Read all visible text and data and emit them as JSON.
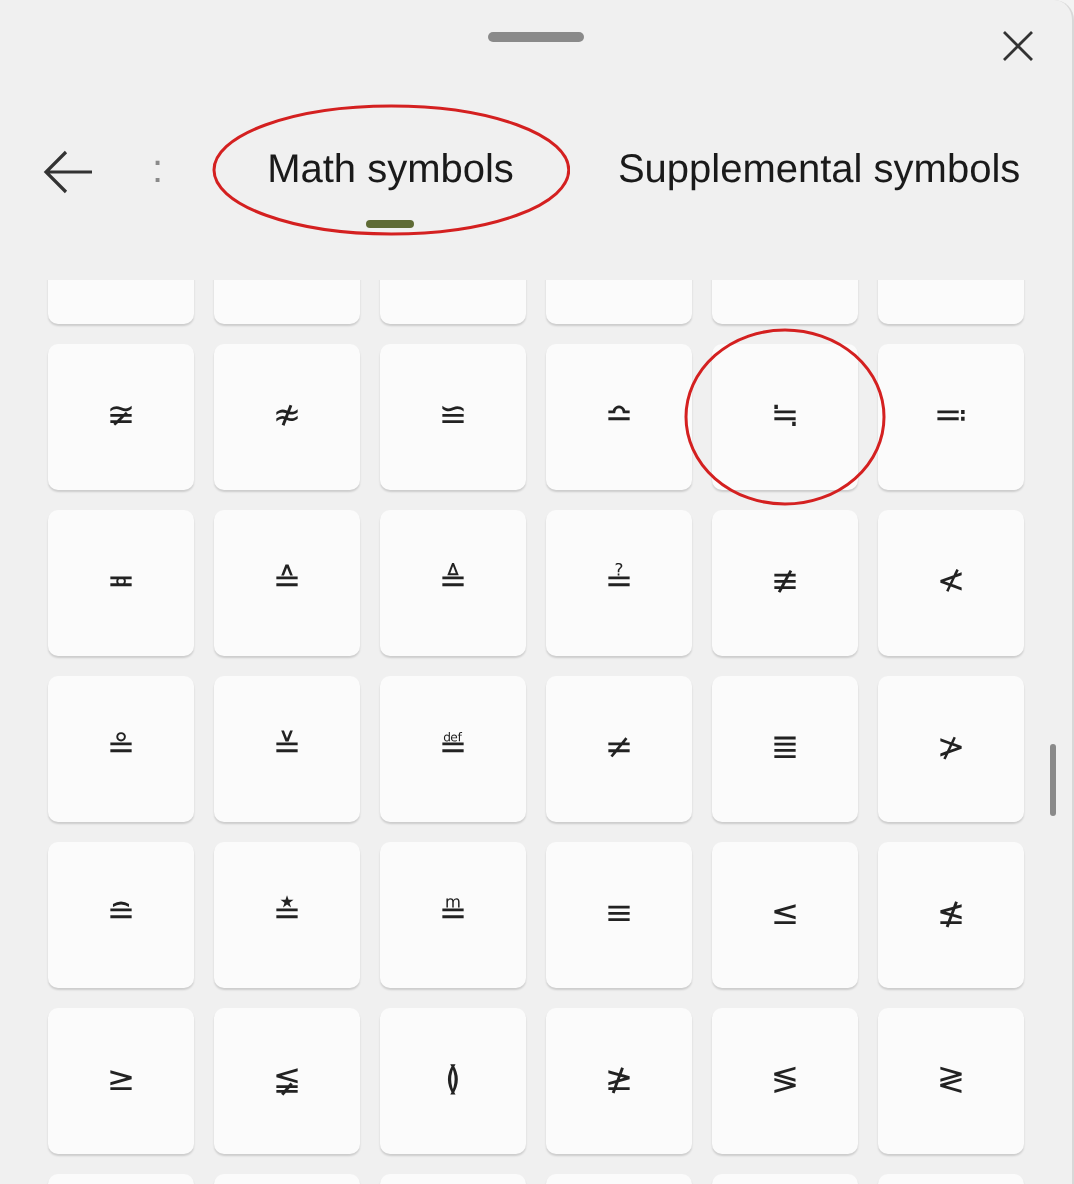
{
  "tabs": [
    {
      "label": ":",
      "selected": false,
      "circled": false
    },
    {
      "label": "Math symbols",
      "selected": true,
      "circled": true
    },
    {
      "label": "Supplemental symbols",
      "selected": false,
      "circled": false
    }
  ],
  "symbols": [
    {
      "symbol": "≆",
      "circled": false
    },
    {
      "symbol": "≉",
      "circled": false
    },
    {
      "symbol": "≌",
      "circled": false
    },
    {
      "symbol": "≏",
      "circled": false
    },
    {
      "symbol": "≒",
      "circled": true
    },
    {
      "symbol": "≕",
      "circled": false
    },
    {
      "symbol": "≖",
      "circled": false
    },
    {
      "symbol": "≙",
      "circled": false
    },
    {
      "symbol": "≜",
      "circled": false
    },
    {
      "symbol": "≟",
      "circled": false
    },
    {
      "symbol": "≢",
      "circled": false
    },
    {
      "symbol": "≮",
      "circled": false
    },
    {
      "symbol": "≗",
      "circled": false
    },
    {
      "symbol": "≚",
      "circled": false
    },
    {
      "symbol": "≝",
      "circled": false
    },
    {
      "symbol": "≠",
      "circled": false
    },
    {
      "symbol": "≣",
      "circled": false
    },
    {
      "symbol": "≯",
      "circled": false
    },
    {
      "symbol": "≘",
      "circled": false
    },
    {
      "symbol": "≛",
      "circled": false
    },
    {
      "symbol": "≞",
      "circled": false
    },
    {
      "symbol": "≡",
      "circled": false
    },
    {
      "symbol": "≤",
      "circled": false
    },
    {
      "symbol": "≰",
      "circled": false
    },
    {
      "symbol": "≥",
      "circled": false
    },
    {
      "symbol": "≨",
      "circled": false
    },
    {
      "symbol": "≬",
      "circled": false
    },
    {
      "symbol": "≱",
      "circled": false
    },
    {
      "symbol": "≶",
      "circled": false
    },
    {
      "symbol": "≷",
      "circled": false
    }
  ]
}
